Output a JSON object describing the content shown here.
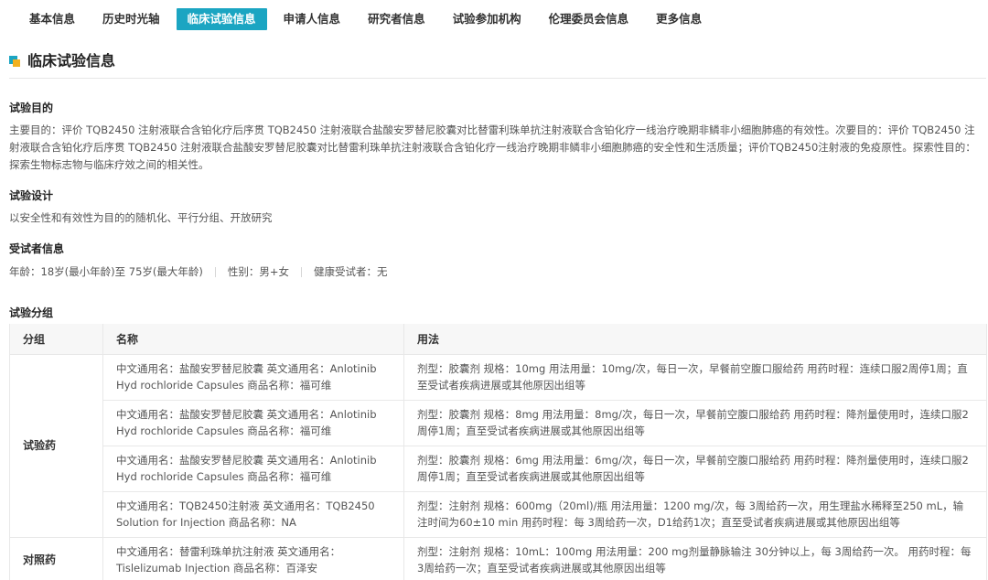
{
  "tabs": [
    {
      "label": "基本信息"
    },
    {
      "label": "历史时光轴"
    },
    {
      "label": "临床试验信息",
      "active": true
    },
    {
      "label": "申请人信息"
    },
    {
      "label": "研究者信息"
    },
    {
      "label": "试验参加机构"
    },
    {
      "label": "伦理委员会信息"
    },
    {
      "label": "更多信息"
    }
  ],
  "section": {
    "title": "临床试验信息"
  },
  "purpose": {
    "label": "试验目的",
    "text": "主要目的：评价 TQB2450 注射液联合含铂化疗后序贯 TQB2450 注射液联合盐酸安罗替尼胶囊对比替雷利珠单抗注射液联合含铂化疗一线治疗晚期非鳞非小细胞肺癌的有效性。次要目的：评价 TQB2450 注射液联合含铂化疗后序贯 TQB2450 注射液联合盐酸安罗替尼胶囊对比替雷利珠单抗注射液联合含铂化疗一线治疗晚期非鳞非小细胞肺癌的安全性和生活质量；评价TQB2450注射液的免疫原性。探索性目的：探索生物标志物与临床疗效之间的相关性。"
  },
  "design": {
    "label": "试验设计",
    "text": "以安全性和有效性为目的的随机化、平行分组、开放研究"
  },
  "subjects": {
    "label": "受试者信息",
    "age": "年龄：18岁(最小年龄)至 75岁(最大年龄)",
    "gender": "性别：男+女",
    "healthy": "健康受试者：无"
  },
  "groups": {
    "label": "试验分组",
    "headers": {
      "group": "分组",
      "name": "名称",
      "usage": "用法"
    },
    "experimental": {
      "label": "试验药",
      "rows": [
        {
          "name": "中文通用名：盐酸安罗替尼胶囊 英文通用名：Anlotinib Hyd rochloride Capsules 商品名称：福可维",
          "usage": "剂型：胶囊剂 规格：10mg 用法用量：10mg/次，每日一次，早餐前空腹口服给药 用药时程：连续口服2周停1周；直至受试者疾病进展或其他原因出组等"
        },
        {
          "name": "中文通用名：盐酸安罗替尼胶囊 英文通用名：Anlotinib Hyd rochloride Capsules 商品名称：福可维",
          "usage": "剂型：胶囊剂 规格：8mg 用法用量：8mg/次，每日一次，早餐前空腹口服给药 用药时程：降剂量使用时，连续口服2周停1周；直至受试者疾病进展或其他原因出组等"
        },
        {
          "name": "中文通用名：盐酸安罗替尼胶囊 英文通用名：Anlotinib Hyd rochloride Capsules 商品名称：福可维",
          "usage": "剂型：胶囊剂 规格：6mg 用法用量：6mg/次，每日一次，早餐前空腹口服给药 用药时程：降剂量使用时，连续口服2周停1周；直至受试者疾病进展或其他原因出组等"
        },
        {
          "name": "中文通用名：TQB2450注射液 英文通用名：TQB2450 Solution for Injection 商品名称：NA",
          "usage": "剂型：注射剂 规格：600mg（20ml)/瓶 用法用量：1200 mg/次，每 3周给药一次，用生理盐水稀释至250 mL，输注时间为60±10 min 用药时程：每 3周给药一次，D1给药1次；直至受试者疾病进展或其他原因出组等"
        }
      ]
    },
    "control": {
      "label": "对照药",
      "rows": [
        {
          "name": "中文通用名：替雷利珠单抗注射液 英文通用名：Tislelizumab Injection 商品名称：百泽安",
          "usage": "剂型：注射剂 规格：10mL：100mg 用法用量：200 mg剂量静脉输注 30分钟以上，每 3周给药一次。 用药时程：每3周给药一次；直至受试者疾病进展或其他原因出组等"
        }
      ]
    }
  },
  "colors": {
    "accent": "#1ba5c2",
    "accent2": "#f2b120"
  }
}
